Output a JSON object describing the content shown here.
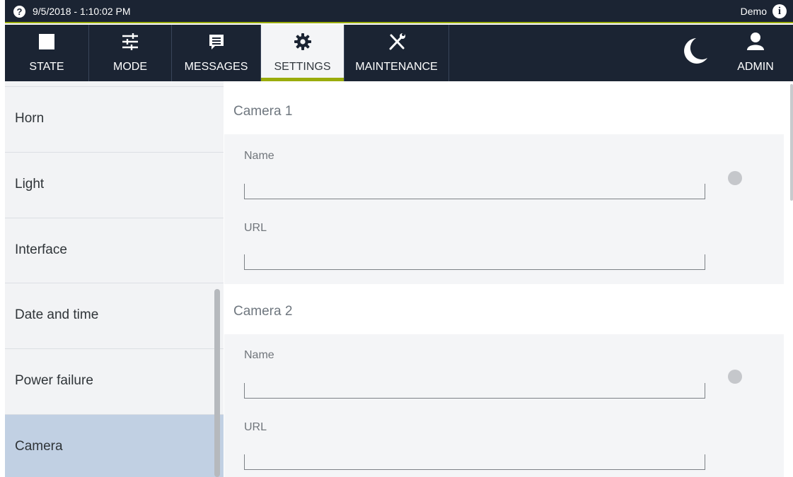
{
  "statusbar": {
    "help_icon": "?",
    "datetime": "9/5/2018 - 1:10:02 PM",
    "user": "Demo",
    "info_icon": "i"
  },
  "nav": {
    "tabs": [
      {
        "label": "STATE",
        "icon": "stop-square-icon"
      },
      {
        "label": "MODE",
        "icon": "sliders-icon"
      },
      {
        "label": "MESSAGES",
        "icon": "message-list-icon"
      },
      {
        "label": "SETTINGS",
        "icon": "gear-icon",
        "active": true
      },
      {
        "label": "MAINTENANCE",
        "icon": "wrench-screwdriver-icon"
      }
    ],
    "night_mode_icon": "moon-icon",
    "admin": {
      "label": "ADMIN",
      "icon": "user-icon"
    }
  },
  "sidebar": {
    "items": [
      {
        "label": "Horn"
      },
      {
        "label": "Light"
      },
      {
        "label": "Interface"
      },
      {
        "label": "Date and time"
      },
      {
        "label": "Power failure"
      },
      {
        "label": "Camera",
        "selected": true
      }
    ]
  },
  "cameras": [
    {
      "title": "Camera 1",
      "name_label": "Name",
      "name_value": "",
      "url_label": "URL",
      "url_value": ""
    },
    {
      "title": "Camera 2",
      "name_label": "Name",
      "name_value": "",
      "url_label": "URL",
      "url_value": ""
    }
  ],
  "colors": {
    "header_bg": "#1b2433",
    "accent": "#9aac0c",
    "selected_item_bg": "#c1d0e3"
  }
}
